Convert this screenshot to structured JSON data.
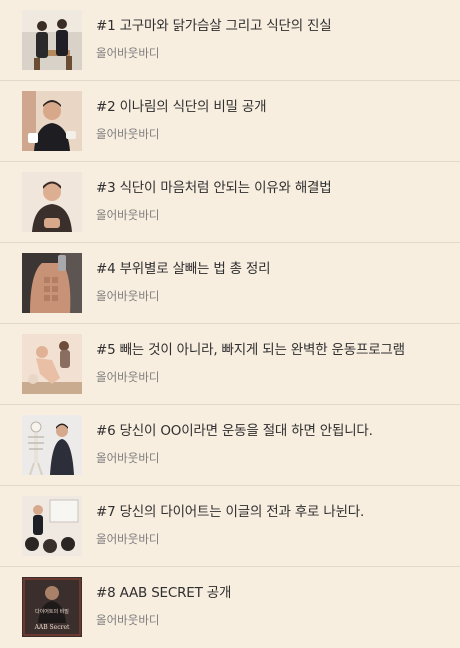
{
  "items": [
    {
      "title": "#1 고구마와 닭가슴살 그리고 식단의 진실",
      "author": "올어바웃바디",
      "thumb_icon": "two-people-seated-photo"
    },
    {
      "title": "#2 이나림의 식단의 비밀 공개",
      "author": "올어바웃바디",
      "thumb_icon": "man-eating-photo"
    },
    {
      "title": "#3 식단이 마음처럼 안되는 이유와 해결법",
      "author": "올어바웃바디",
      "thumb_icon": "man-portrait-photo"
    },
    {
      "title": "#4 부위별로 살빼는 법 총 정리",
      "author": "올어바웃바디",
      "thumb_icon": "abs-selfie-photo"
    },
    {
      "title": "#5 빼는 것이 아니라, 빠지게 되는 완벽한 운동프로그램",
      "author": "올어바웃바디",
      "thumb_icon": "workout-photo"
    },
    {
      "title": "#6 당신이 OO이라면 운동을 절대 하면 안됩니다.",
      "author": "올어바웃바디",
      "thumb_icon": "skeleton-model-photo"
    },
    {
      "title": "#7 당신의 다이어트는 이글의 전과 후로 나뉜다.",
      "author": "올어바웃바디",
      "thumb_icon": "seminar-photo"
    },
    {
      "title": "#8 AAB SECRET 공개",
      "author": "올어바웃바디",
      "thumb_icon": "aab-secret-photo",
      "thumb_text": [
        "다이어트의 비밀",
        "AAB Secret"
      ]
    }
  ]
}
